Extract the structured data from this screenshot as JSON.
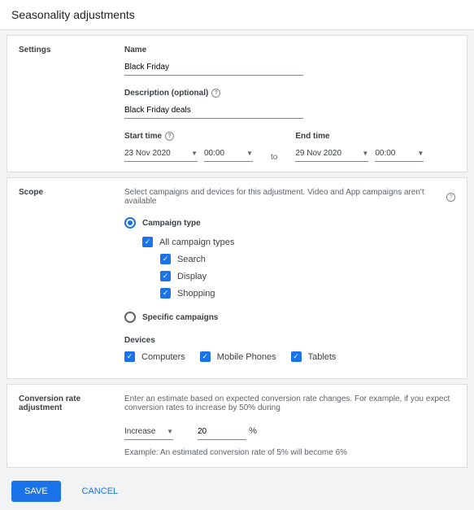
{
  "pageTitle": "Seasonality adjustments",
  "settings": {
    "sectionLabel": "Settings",
    "nameLabel": "Name",
    "nameValue": "Black Friday",
    "descLabel": "Description (optional)",
    "descValue": "Black Friday deals",
    "startLabel": "Start time",
    "startDate": "23 Nov 2020",
    "startTime": "00:00",
    "toLabel": "to",
    "endLabel": "End time",
    "endDate": "29 Nov 2020",
    "endTime": "00:00"
  },
  "scope": {
    "sectionLabel": "Scope",
    "description": "Select campaigns and devices for this adjustment. Video and App campaigns aren't available",
    "campaignTypeLabel": "Campaign type",
    "allTypesLabel": "All campaign types",
    "searchLabel": "Search",
    "displayLabel": "Display",
    "shoppingLabel": "Shopping",
    "specificLabel": "Specific campaigns",
    "devicesLabel": "Devices",
    "computersLabel": "Computers",
    "mobileLabel": "Mobile Phones",
    "tabletsLabel": "Tablets"
  },
  "adjustment": {
    "sectionLabel": "Conversion rate adjustment",
    "description": "Enter an estimate based on expected conversion rate changes. For example, if you expect conversion rates to increase by 50% during",
    "direction": "Increase",
    "pctValue": "20",
    "pctSuffix": "%",
    "example": "Example: An estimated conversion rate of 5% will become 6%"
  },
  "actions": {
    "save": "SAVE",
    "cancel": "CANCEL"
  }
}
